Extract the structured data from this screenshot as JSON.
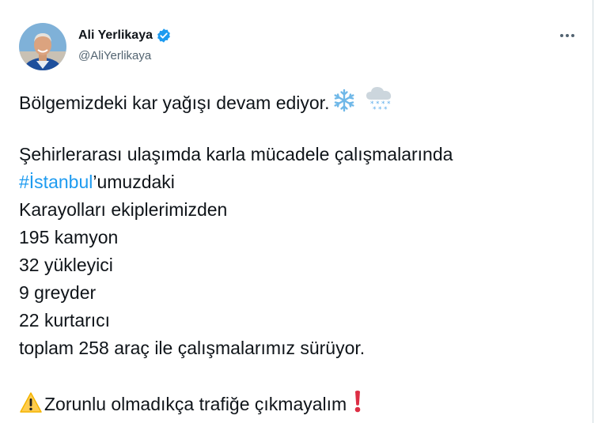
{
  "user": {
    "display_name": "Ali Yerlikaya",
    "handle": "@AliYerlikaya",
    "verified": true,
    "verified_color": "#1d9bf0"
  },
  "more_icon": "more-horizontal-icon",
  "tweet": {
    "line1": "Bölgemizdeki kar yağışı devam ediyor.",
    "line1_emojis": [
      "snowflake-icon",
      "cloud-with-snow-icon"
    ],
    "line2": "Şehirlerarası ulaşımda karla mücadele çalışmalarında",
    "hashtag": "#İstanbul",
    "line3_rest": "’umuzdaki",
    "line4": "Karayolları ekiplerimizden",
    "line5": "195 kamyon",
    "line6": "32 yükleyici",
    "line7": "9 greyder",
    "line8": "22 kurtarıcı",
    "line9": "toplam 258 araç ile çalışmalarımız sürüyor.",
    "warning_emoji": "warning-icon",
    "line10": "Zorunlu olmadıkça trafiğe çıkmayalım",
    "exclamation_emoji": "red-exclamation-icon"
  },
  "colors": {
    "text": "#0f1419",
    "secondary": "#536471",
    "link": "#1d9bf0"
  }
}
